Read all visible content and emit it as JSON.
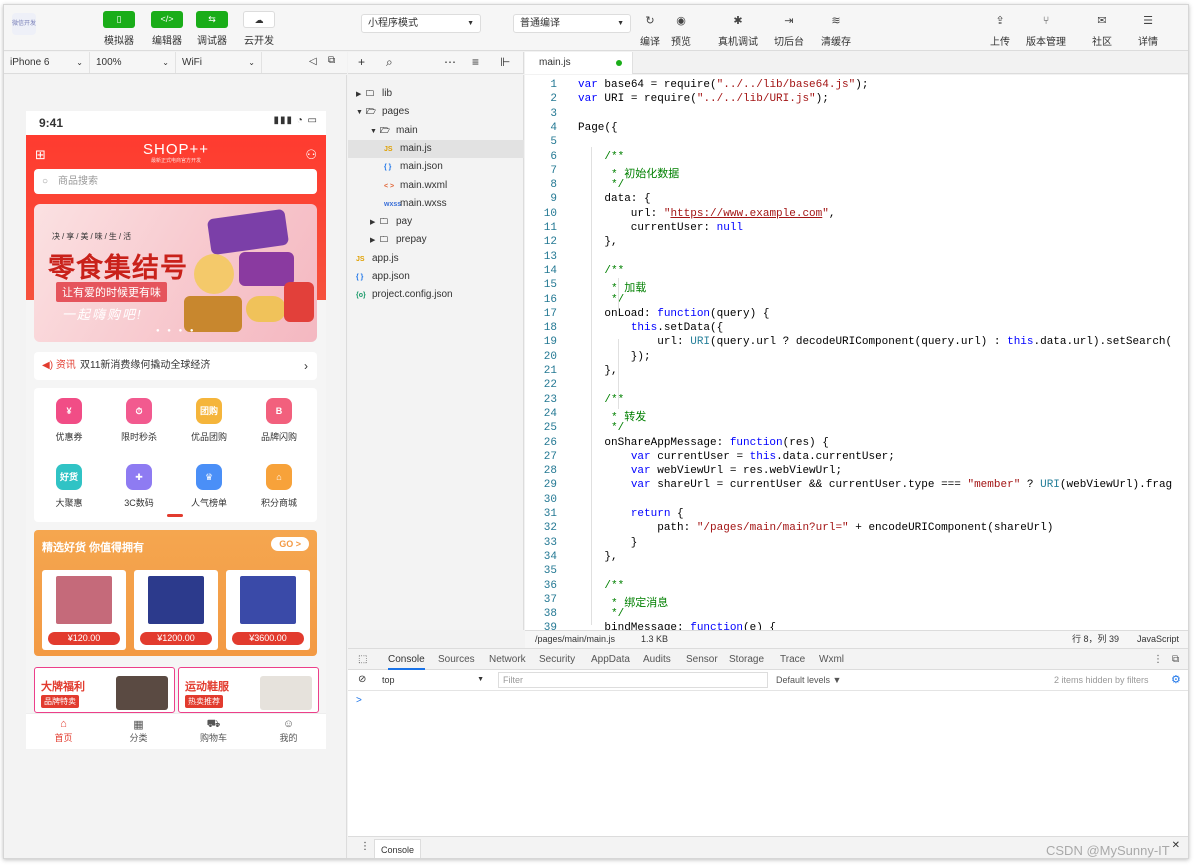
{
  "toolbar": {
    "logo_text": "微信开发",
    "left": [
      {
        "label": "模拟器",
        "icon": "phone-icon"
      },
      {
        "label": "编辑器",
        "icon": "code-icon"
      },
      {
        "label": "调试器",
        "icon": "debug-icon"
      },
      {
        "label": "云开发",
        "icon": "cloud-icon"
      }
    ],
    "mode_select": "小程序模式",
    "compile_select": "普通编译",
    "actions": [
      {
        "label": "编译",
        "icon": "refresh-icon"
      },
      {
        "label": "预览",
        "icon": "eye-icon"
      },
      {
        "label": "真机调试",
        "icon": "bug-icon"
      },
      {
        "label": "切后台",
        "icon": "switch-icon"
      },
      {
        "label": "清缓存",
        "icon": "layers-icon"
      }
    ],
    "right": [
      {
        "label": "上传",
        "icon": "upload-icon"
      },
      {
        "label": "版本管理",
        "icon": "version-icon"
      },
      {
        "label": "社区",
        "icon": "chat-icon"
      },
      {
        "label": "详情",
        "icon": "menu-icon"
      }
    ]
  },
  "device_bar": {
    "device": "iPhone 6",
    "zoom": "100%",
    "network": "WiFi"
  },
  "phone": {
    "time": "9:41",
    "signal": "▮▮▮ ◔ ▭",
    "brand": "SHOP++",
    "brand_sub": "最新正式电商官方开发",
    "search_placeholder": "商品搜索",
    "banner": {
      "small": "决/享/美/味/生/活",
      "big": "零食集结号",
      "sub": "让有爱的时候更有味",
      "cta": "一起嗨购吧!"
    },
    "news": {
      "tag": "资讯",
      "text": "双11新消费缘何撬动全球经济"
    },
    "grid": [
      {
        "label": "优惠券",
        "glyph": "¥",
        "color": "#f14d86"
      },
      {
        "label": "限时秒杀",
        "glyph": "⏱",
        "color": "#f25a8f"
      },
      {
        "label": "优品团购",
        "glyph": "团购",
        "color": "#f5b53b"
      },
      {
        "label": "品牌闪购",
        "glyph": "B",
        "color": "#f2607d"
      },
      {
        "label": "大聚惠",
        "glyph": "好货",
        "color": "#30c3c5"
      },
      {
        "label": "3C数码",
        "glyph": "✚",
        "color": "#8e7bf2"
      },
      {
        "label": "人气榜单",
        "glyph": "♛",
        "color": "#4a8ff7"
      },
      {
        "label": "积分商城",
        "glyph": "⌂",
        "color": "#f7a23a"
      }
    ],
    "good_title": "精选好货 你值得拥有",
    "good_go": "GO >",
    "goods": [
      {
        "price": "¥120.00",
        "color": "#c56a7a"
      },
      {
        "price": "¥1200.00",
        "color": "#2c3a8c"
      },
      {
        "price": "¥3600.00",
        "color": "#3a4aa8"
      }
    ],
    "promos": [
      {
        "title": "大牌福利",
        "badge": "品牌特卖",
        "color": "#5a4a42"
      },
      {
        "title": "运动鞋服",
        "badge": "热卖推荐",
        "color": "#e6e2dc"
      }
    ],
    "tabs": [
      {
        "label": "首页",
        "icon": "⌂",
        "active": true
      },
      {
        "label": "分类",
        "icon": "▦",
        "active": false
      },
      {
        "label": "购物车",
        "icon": "⛟",
        "active": false
      },
      {
        "label": "我的",
        "icon": "☺",
        "active": false
      }
    ]
  },
  "explorer": {
    "tree": [
      {
        "label": "lib",
        "type": "folder",
        "open": false,
        "depth": 0
      },
      {
        "label": "pages",
        "type": "folder",
        "open": true,
        "depth": 0
      },
      {
        "label": "main",
        "type": "folder",
        "open": true,
        "depth": 1
      },
      {
        "label": "main.js",
        "type": "js",
        "depth": 2,
        "selected": true
      },
      {
        "label": "main.json",
        "type": "json",
        "depth": 2
      },
      {
        "label": "main.wxml",
        "type": "wxml",
        "depth": 2
      },
      {
        "label": "main.wxss",
        "type": "wxss",
        "depth": 2
      },
      {
        "label": "pay",
        "type": "folder",
        "open": false,
        "depth": 1
      },
      {
        "label": "prepay",
        "type": "folder",
        "open": false,
        "depth": 1
      },
      {
        "label": "app.js",
        "type": "js",
        "depth": 0
      },
      {
        "label": "app.json",
        "type": "json",
        "depth": 0
      },
      {
        "label": "project.config.json",
        "type": "config",
        "depth": 0
      }
    ],
    "file_badges": {
      "js": "JS",
      "json": "{ }",
      "wxml": "< >",
      "wxss": "wxss",
      "config": "{o}"
    }
  },
  "editor": {
    "tab": "main.js",
    "lines": [
      "var base64 = require(\"../../lib/base64.js\");",
      "var URI = require(\"../../lib/URI.js\");",
      "",
      "Page({",
      "",
      "    /**",
      "     * 初始化数据",
      "     */",
      "    data: {",
      "        url: \"https://www.example.com\",",
      "        currentUser: null",
      "    },",
      "",
      "    /**",
      "     * 加载",
      "     */",
      "    onLoad: function(query) {",
      "        this.setData({",
      "            url: URI(query.url ? decodeURIComponent(query.url) : this.data.url).setSearch(",
      "        });",
      "    },",
      "",
      "    /**",
      "     * 转发",
      "     */",
      "    onShareAppMessage: function(res) {",
      "        var currentUser = this.data.currentUser;",
      "        var webViewUrl = res.webViewUrl;",
      "        var shareUrl = currentUser && currentUser.type === \"member\" ? URI(webViewUrl).frag",
      "",
      "        return {",
      "            path: \"/pages/main/main?url=\" + encodeURIComponent(shareUrl)",
      "        }",
      "    },",
      "",
      "    /**",
      "     * 绑定消息",
      "     */",
      "    bindMessage: function(e) {"
    ],
    "status_path": "/pages/main/main.js",
    "status_size": "1.3 KB",
    "status_pos": "行 8，列 39",
    "status_lang": "JavaScript"
  },
  "console": {
    "tabs": [
      "Console",
      "Sources",
      "Network",
      "Security",
      "AppData",
      "Audits",
      "Sensor",
      "Storage",
      "Trace",
      "Wxml"
    ],
    "context": "top",
    "filter_placeholder": "Filter",
    "levels": "Default levels ▼",
    "hidden": "2 items hidden by filters",
    "prompt": ">",
    "drawer_tab": "Console"
  },
  "watermark": "CSDN @MySunny-IT"
}
